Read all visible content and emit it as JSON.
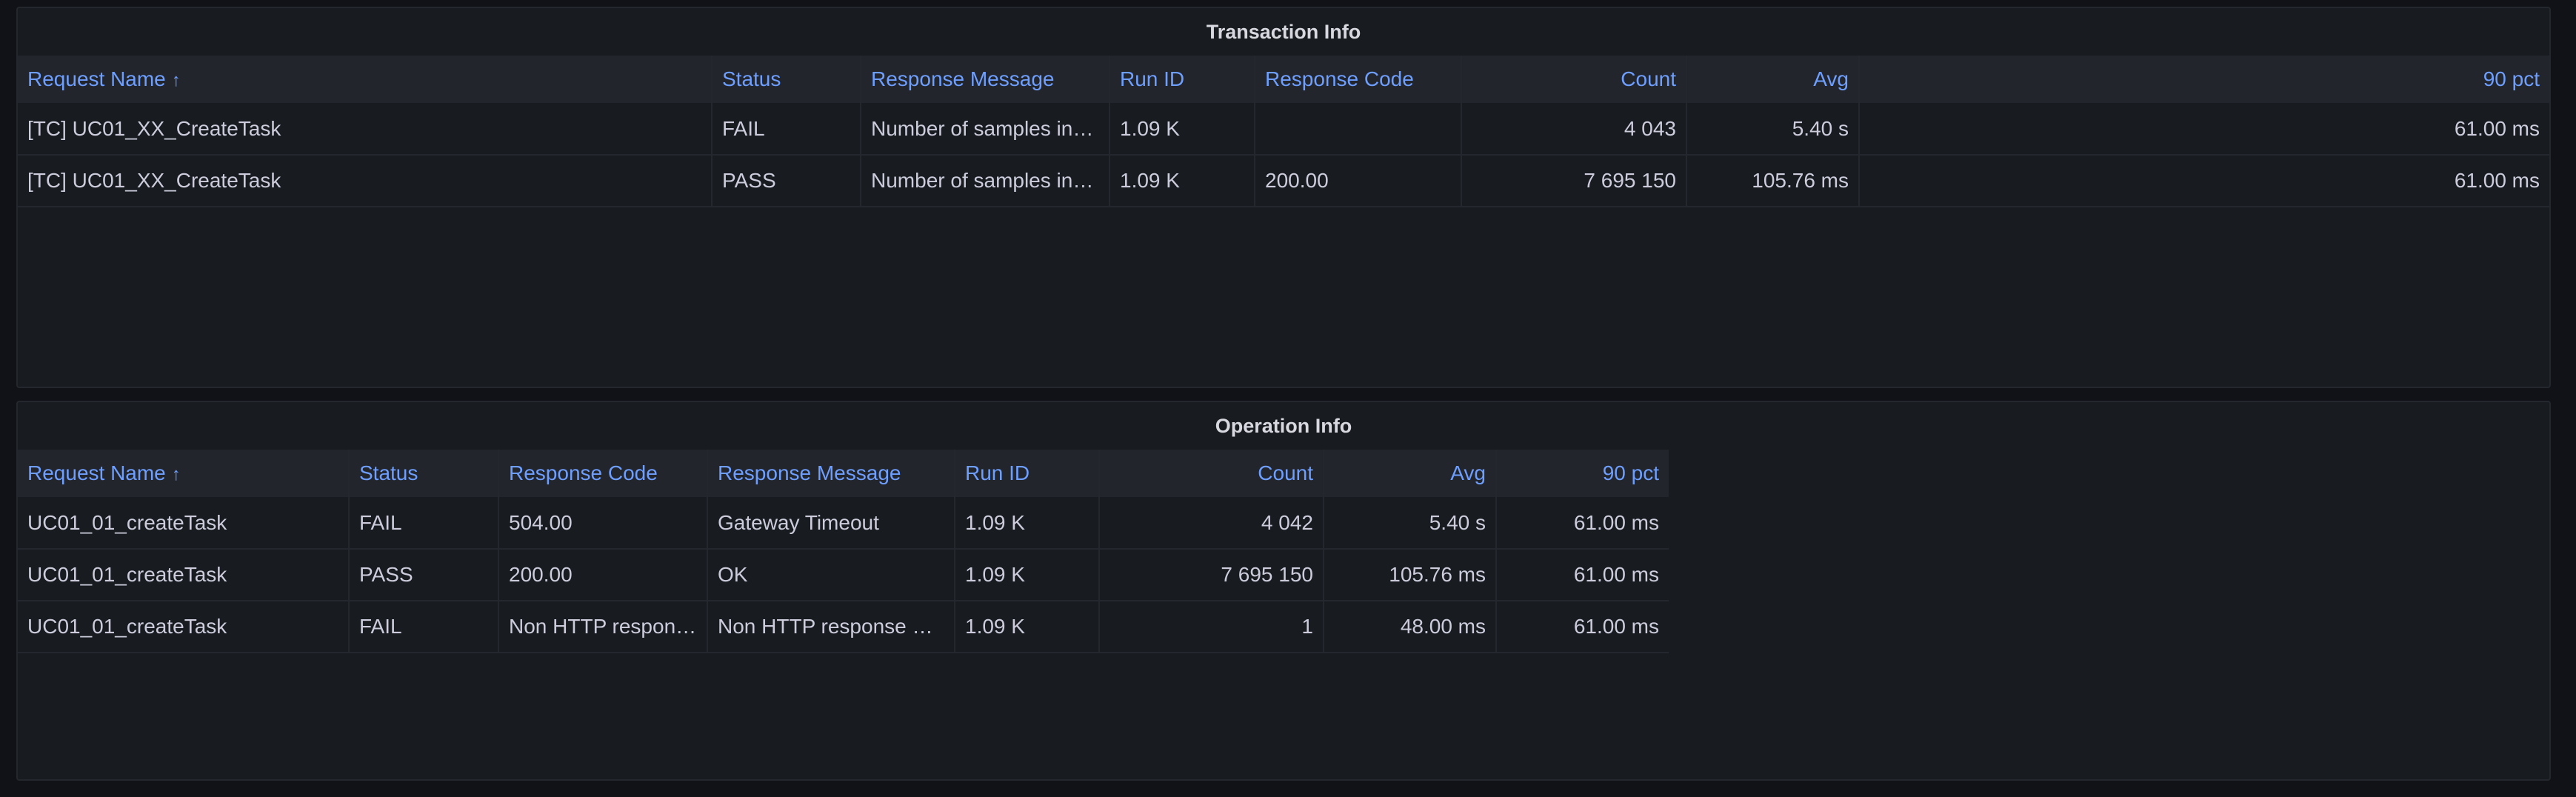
{
  "panels": {
    "transaction": {
      "title": "Transaction Info",
      "columns": [
        "Request Name",
        "Status",
        "Response Message",
        "Run ID",
        "Response Code",
        "Count",
        "Avg",
        "90 pct"
      ],
      "sort_indicator": "↑",
      "rows": [
        [
          "[TC] UC01_XX_CreateTask",
          "FAIL",
          "Number of samples in …",
          "1.09 K",
          "",
          "4 043",
          "5.40 s",
          "61.00 ms"
        ],
        [
          "[TC] UC01_XX_CreateTask",
          "PASS",
          "Number of samples in …",
          "1.09 K",
          "200.00",
          "7 695 150",
          "105.76 ms",
          "61.00 ms"
        ]
      ]
    },
    "operation": {
      "title": "Operation Info",
      "columns": [
        "Request Name",
        "Status",
        "Response Code",
        "Response Message",
        "Run ID",
        "Count",
        "Avg",
        "90 pct"
      ],
      "sort_indicator": "↑",
      "rows": [
        [
          "UC01_01_createTask",
          "FAIL",
          "504.00",
          "Gateway Timeout",
          "1.09 K",
          "4 042",
          "5.40 s",
          "61.00 ms"
        ],
        [
          "UC01_01_createTask",
          "PASS",
          "200.00",
          "OK",
          "1.09 K",
          "7 695 150",
          "105.76 ms",
          "61.00 ms"
        ],
        [
          "UC01_01_createTask",
          "FAIL",
          "Non HTTP respon…",
          "Non HTTP response m…",
          "1.09 K",
          "1",
          "48.00 ms",
          "61.00 ms"
        ]
      ]
    }
  },
  "colors": {
    "header_text": "#6e9fff",
    "panel_bg": "#181b1f",
    "page_bg": "#111217"
  }
}
